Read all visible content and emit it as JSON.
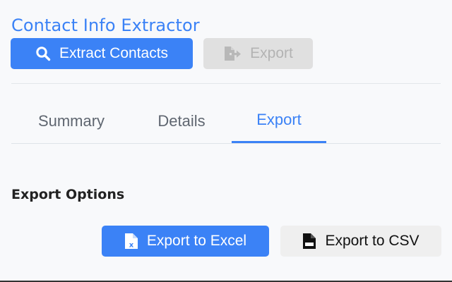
{
  "app": {
    "title": "Contact Info Extractor"
  },
  "toolbar": {
    "extract_label": "Extract Contacts",
    "export_label": "Export",
    "export_disabled": true
  },
  "tabs": [
    {
      "label": "Summary",
      "active": false
    },
    {
      "label": "Details",
      "active": false
    },
    {
      "label": "Export",
      "active": true
    }
  ],
  "export_panel": {
    "section_title": "Export Options",
    "excel_label": "Export to Excel",
    "csv_label": "Export to CSV"
  },
  "colors": {
    "accent": "#3b82f6",
    "disabled_bg": "#e0e0e0",
    "disabled_text": "#b3b3b3",
    "page_bg": "#f8f9fb"
  },
  "icons": {
    "extract": "search-icon",
    "export": "file-export-icon",
    "excel": "file-excel-icon",
    "csv": "file-csv-icon"
  }
}
